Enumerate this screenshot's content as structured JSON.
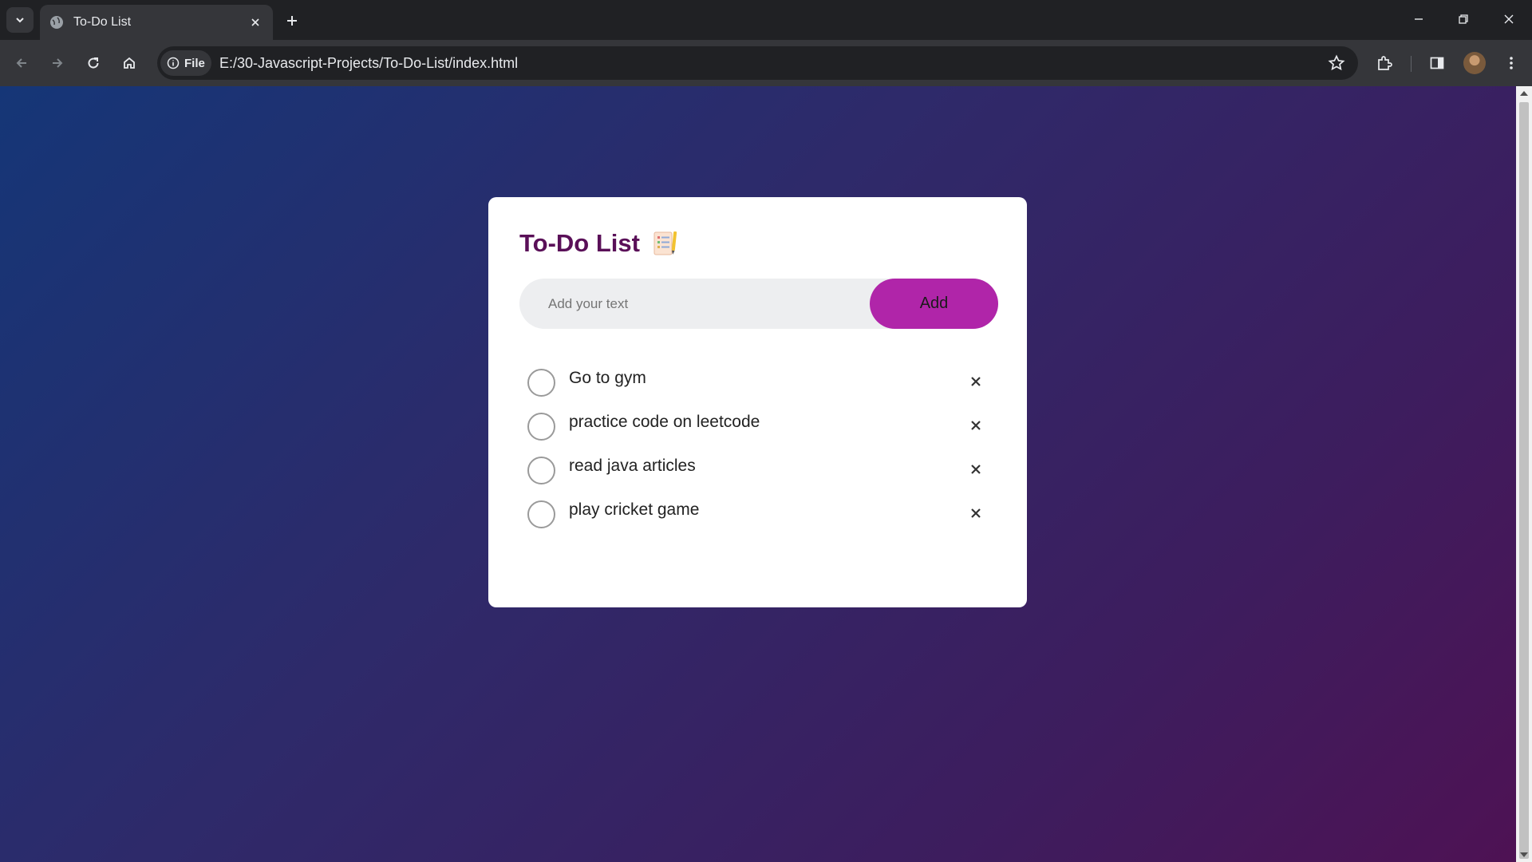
{
  "browser": {
    "tab_title": "To-Do List",
    "site_chip_label": "File",
    "url": "E:/30-Javascript-Projects/To-Do-List/index.html"
  },
  "app": {
    "title": "To-Do List",
    "title_icon": "notepad-icon",
    "input_placeholder": "Add your text",
    "input_value": "",
    "add_label": "Add",
    "accent_color": "#b025a9",
    "title_color": "#5a1058",
    "tasks": [
      {
        "text": "Go to gym",
        "checked": false
      },
      {
        "text": "practice code on leetcode",
        "checked": false
      },
      {
        "text": "read java articles",
        "checked": false
      },
      {
        "text": "play cricket game",
        "checked": false
      }
    ],
    "remove_glyph": "×"
  }
}
